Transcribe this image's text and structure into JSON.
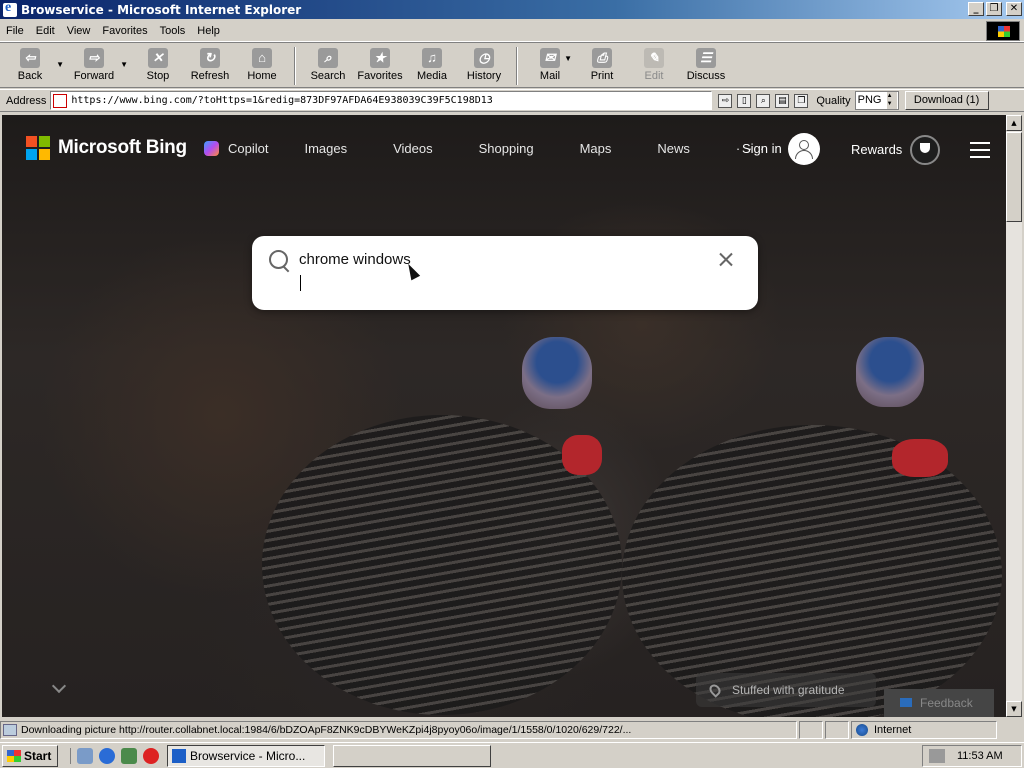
{
  "window": {
    "title": "Browservice - Microsoft Internet Explorer",
    "controls": [
      "minimize",
      "restore",
      "close"
    ]
  },
  "menu": [
    "File",
    "Edit",
    "View",
    "Favorites",
    "Tools",
    "Help"
  ],
  "toolbar": [
    {
      "label": "Back",
      "icon": "back-arrow-icon",
      "dropdown": true,
      "enabled": true
    },
    {
      "label": "Forward",
      "icon": "forward-arrow-icon",
      "dropdown": true,
      "enabled": true
    },
    {
      "label": "Stop",
      "icon": "stop-icon",
      "enabled": true
    },
    {
      "label": "Refresh",
      "icon": "refresh-icon",
      "enabled": true
    },
    {
      "label": "Home",
      "icon": "home-icon",
      "enabled": true
    },
    {
      "label": "Search",
      "icon": "search-icon",
      "enabled": true
    },
    {
      "label": "Favorites",
      "icon": "favorites-icon",
      "enabled": true
    },
    {
      "label": "Media",
      "icon": "media-icon",
      "enabled": true
    },
    {
      "label": "History",
      "icon": "history-icon",
      "enabled": true
    },
    {
      "label": "Mail",
      "icon": "mail-icon",
      "dropdown": true,
      "enabled": true
    },
    {
      "label": "Print",
      "icon": "print-icon",
      "enabled": true
    },
    {
      "label": "Edit",
      "icon": "edit-icon",
      "enabled": false
    },
    {
      "label": "Discuss",
      "icon": "discuss-icon",
      "enabled": true
    }
  ],
  "address": {
    "label": "Address",
    "url": "https://www.bing.com/?toHttps=1&redig=873DF97AFDA64E938039C39F5C198D13",
    "quality_label": "Quality",
    "quality_value": "PNG",
    "download_label": "Download (1)"
  },
  "bing": {
    "logo_text": "Microsoft Bing",
    "nav": [
      "Copilot",
      "Images",
      "Videos",
      "Shopping",
      "Maps",
      "News",
      "· · ·"
    ],
    "sign_in": "Sign in",
    "rewards": "Rewards",
    "search_query": "chrome windows",
    "caption": "Stuffed with gratitude",
    "feedback": "Feedback"
  },
  "status": {
    "text": "Downloading picture http://router.collabnet.local:1984/6/bDZOApF8ZNK9cDBYWeKZpi4j8pyoy06o/image/1/1558/0/1020/629/722/...",
    "zone": "Internet"
  },
  "taskbar": {
    "start": "Start",
    "active_task": "Browservice - Micro...",
    "clock": "11:53 AM"
  },
  "colors": {
    "titlebar_start": "#0a246a",
    "titlebar_end": "#a6caf0",
    "ms_red": "#f25022",
    "ms_green": "#7fba00",
    "ms_blue": "#00a4ef",
    "ms_yellow": "#ffb900"
  }
}
